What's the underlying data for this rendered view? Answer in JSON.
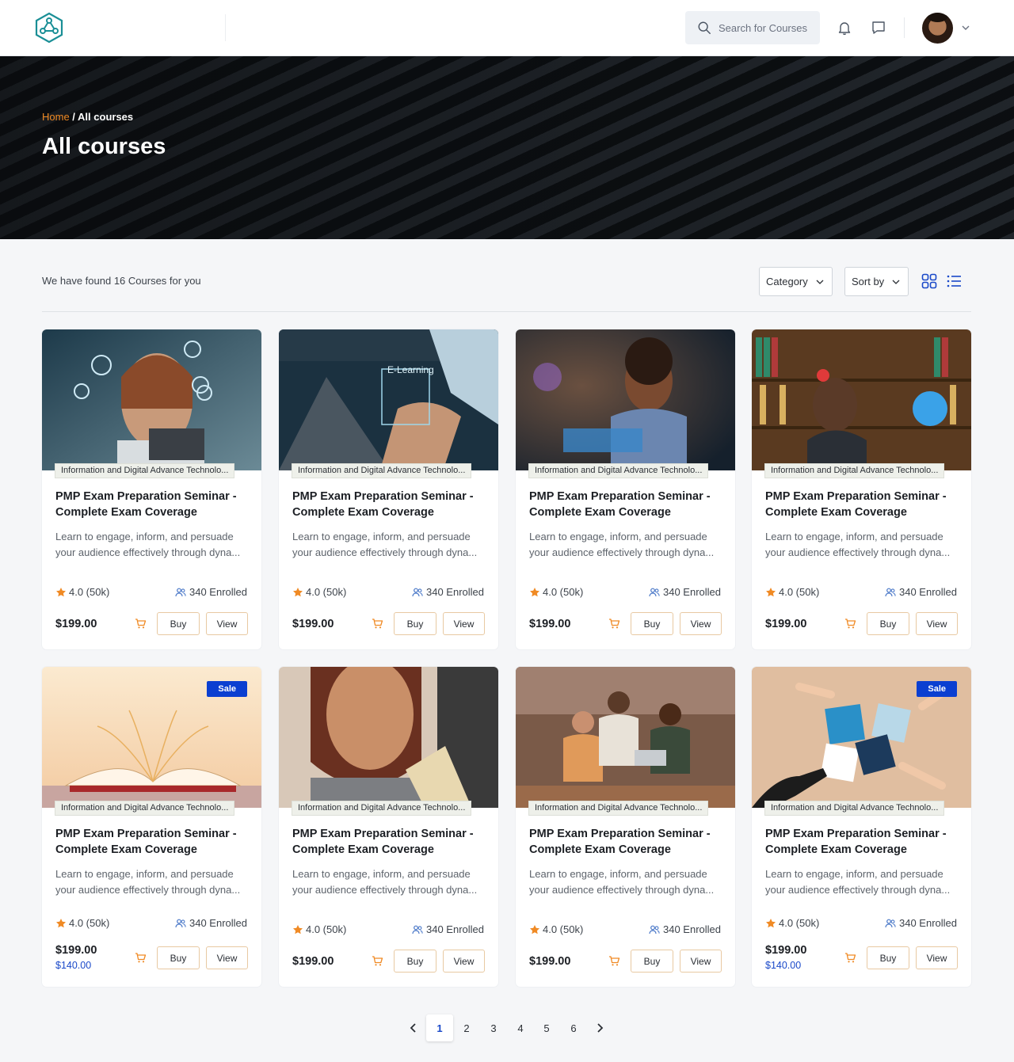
{
  "header": {
    "search_placeholder": "Search for Courses"
  },
  "hero": {
    "breadcrumb_home": "Home",
    "breadcrumb_sep": " / ",
    "breadcrumb_current": "All courses",
    "title": "All courses"
  },
  "toolbar": {
    "found_text": "We have found 16 Courses for you",
    "category_label": "Category",
    "sort_label": "Sort by"
  },
  "cards": [
    {
      "category": "Information and Digital Advance Technolo...",
      "title": "PMP Exam Preparation Seminar - Complete Exam Coverage",
      "desc": "Learn to engage, inform, and persuade your audience effectively through dyna...",
      "rating": "4.0 (50k)",
      "enrolled": "340 Enrolled",
      "price": "$199.00",
      "buy": "Buy",
      "view": "View"
    },
    {
      "category": "Information and Digital Advance Technolo...",
      "title": "PMP Exam Preparation Seminar - Complete Exam Coverage",
      "desc": "Learn to engage, inform, and persuade your audience effectively through dyna...",
      "rating": "4.0 (50k)",
      "enrolled": "340 Enrolled",
      "price": "$199.00",
      "buy": "Buy",
      "view": "View",
      "image_text": "E-Learning"
    },
    {
      "category": "Information and Digital Advance Technolo...",
      "title": "PMP Exam Preparation Seminar - Complete Exam Coverage",
      "desc": "Learn to engage, inform, and persuade your audience effectively through dyna...",
      "rating": "4.0 (50k)",
      "enrolled": "340 Enrolled",
      "price": "$199.00",
      "buy": "Buy",
      "view": "View"
    },
    {
      "category": "Information and Digital Advance Technolo...",
      "title": "PMP Exam Preparation Seminar - Complete Exam Coverage",
      "desc": "Learn to engage, inform, and persuade your audience effectively through dyna...",
      "rating": "4.0 (50k)",
      "enrolled": "340 Enrolled",
      "price": "$199.00",
      "buy": "Buy",
      "view": "View"
    },
    {
      "category": "Information and Digital Advance Technolo...",
      "title": "PMP Exam Preparation Seminar - Complete Exam Coverage",
      "desc": "Learn to engage, inform, and persuade your audience effectively through dyna...",
      "rating": "4.0 (50k)",
      "enrolled": "340 Enrolled",
      "price": "$199.00",
      "sale_price": "$140.00",
      "badge": "Sale",
      "buy": "Buy",
      "view": "View"
    },
    {
      "category": "Information and Digital Advance Technolo...",
      "title": "PMP Exam Preparation Seminar - Complete Exam Coverage",
      "desc": "Learn to engage, inform, and persuade your audience effectively through dyna...",
      "rating": "4.0 (50k)",
      "enrolled": "340 Enrolled",
      "price": "$199.00",
      "buy": "Buy",
      "view": "View"
    },
    {
      "category": "Information and Digital Advance Technolo...",
      "title": "PMP Exam Preparation Seminar - Complete Exam Coverage",
      "desc": "Learn to engage, inform, and persuade your audience effectively through dyna...",
      "rating": "4.0 (50k)",
      "enrolled": "340 Enrolled",
      "price": "$199.00",
      "buy": "Buy",
      "view": "View"
    },
    {
      "category": "Information and Digital Advance Technolo...",
      "title": "PMP Exam Preparation Seminar - Complete Exam Coverage",
      "desc": "Learn to engage, inform, and persuade your audience effectively through dyna...",
      "rating": "4.0 (50k)",
      "enrolled": "340 Enrolled",
      "price": "$199.00",
      "sale_price": "$140.00",
      "badge": "Sale",
      "buy": "Buy",
      "view": "View"
    }
  ],
  "pagination": {
    "pages": [
      "1",
      "2",
      "3",
      "4",
      "5",
      "6"
    ],
    "current": "1"
  },
  "colors": {
    "accent_orange": "#f08a24",
    "brand_teal": "#1a8f96",
    "sale_blue": "#0b3fd1",
    "sale_price_blue": "#1a49c9"
  },
  "icons": [
    "logo-icon",
    "search-icon",
    "bell-icon",
    "chat-icon",
    "chevron-down-icon",
    "grid-view-icon",
    "list-view-icon",
    "star-icon",
    "users-icon",
    "cart-icon",
    "chevron-left-icon",
    "chevron-right-icon"
  ]
}
